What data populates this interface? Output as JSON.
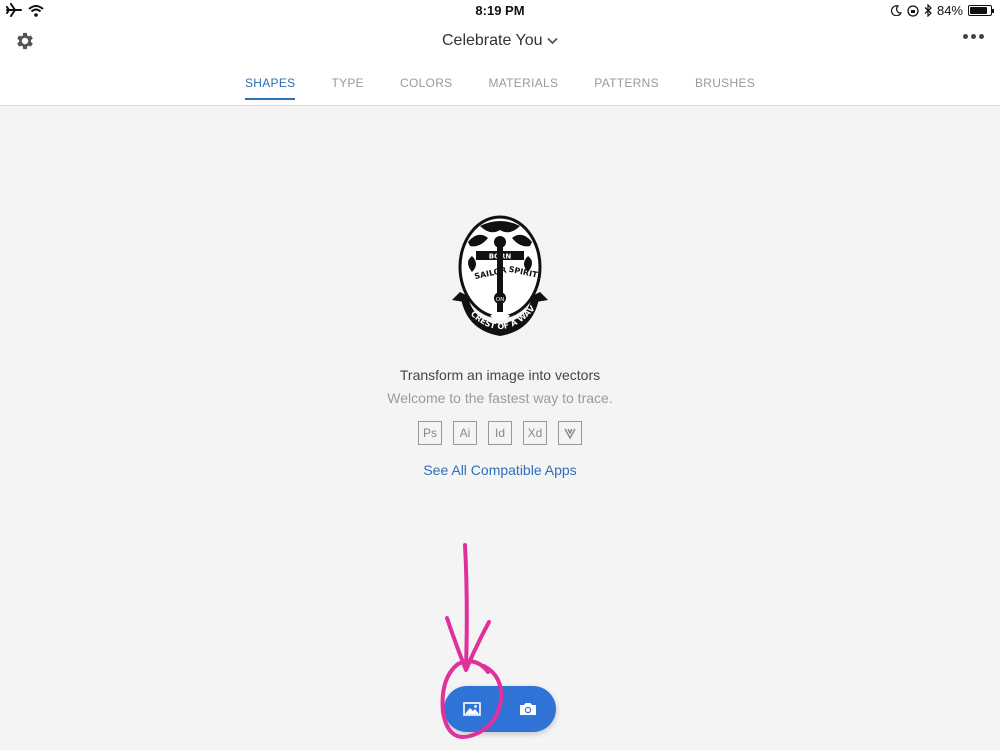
{
  "status_bar": {
    "time": "8:19 PM",
    "battery": "84%",
    "battery_level": 0.84
  },
  "header": {
    "title": "Celebrate You",
    "tabs": [
      {
        "label": "SHAPES",
        "active": true
      },
      {
        "label": "TYPE",
        "active": false
      },
      {
        "label": "COLORS",
        "active": false
      },
      {
        "label": "MATERIALS",
        "active": false
      },
      {
        "label": "PATTERNS",
        "active": false
      },
      {
        "label": "BRUSHES",
        "active": false
      }
    ]
  },
  "main": {
    "illustration_icon": "anchor-crest-emblem",
    "illustration_text": [
      "BORN",
      "SAILOR",
      "SPIRIT",
      "ON",
      "CREST OF A WAVE"
    ],
    "heading": "Transform an image into vectors",
    "subheading": "Welcome to the fastest way to trace.",
    "compatible_apps": [
      "Ps",
      "Ai",
      "Id",
      "Xd",
      "V"
    ],
    "see_all_link": "See All Compatible Apps"
  },
  "actions": {
    "image_button_icon": "image-icon",
    "camera_button_icon": "camera-icon"
  },
  "colors": {
    "accent": "#2d6fb8",
    "fab": "#2f73d7",
    "annotation": "#e0309c",
    "background": "#f4f4f4"
  }
}
